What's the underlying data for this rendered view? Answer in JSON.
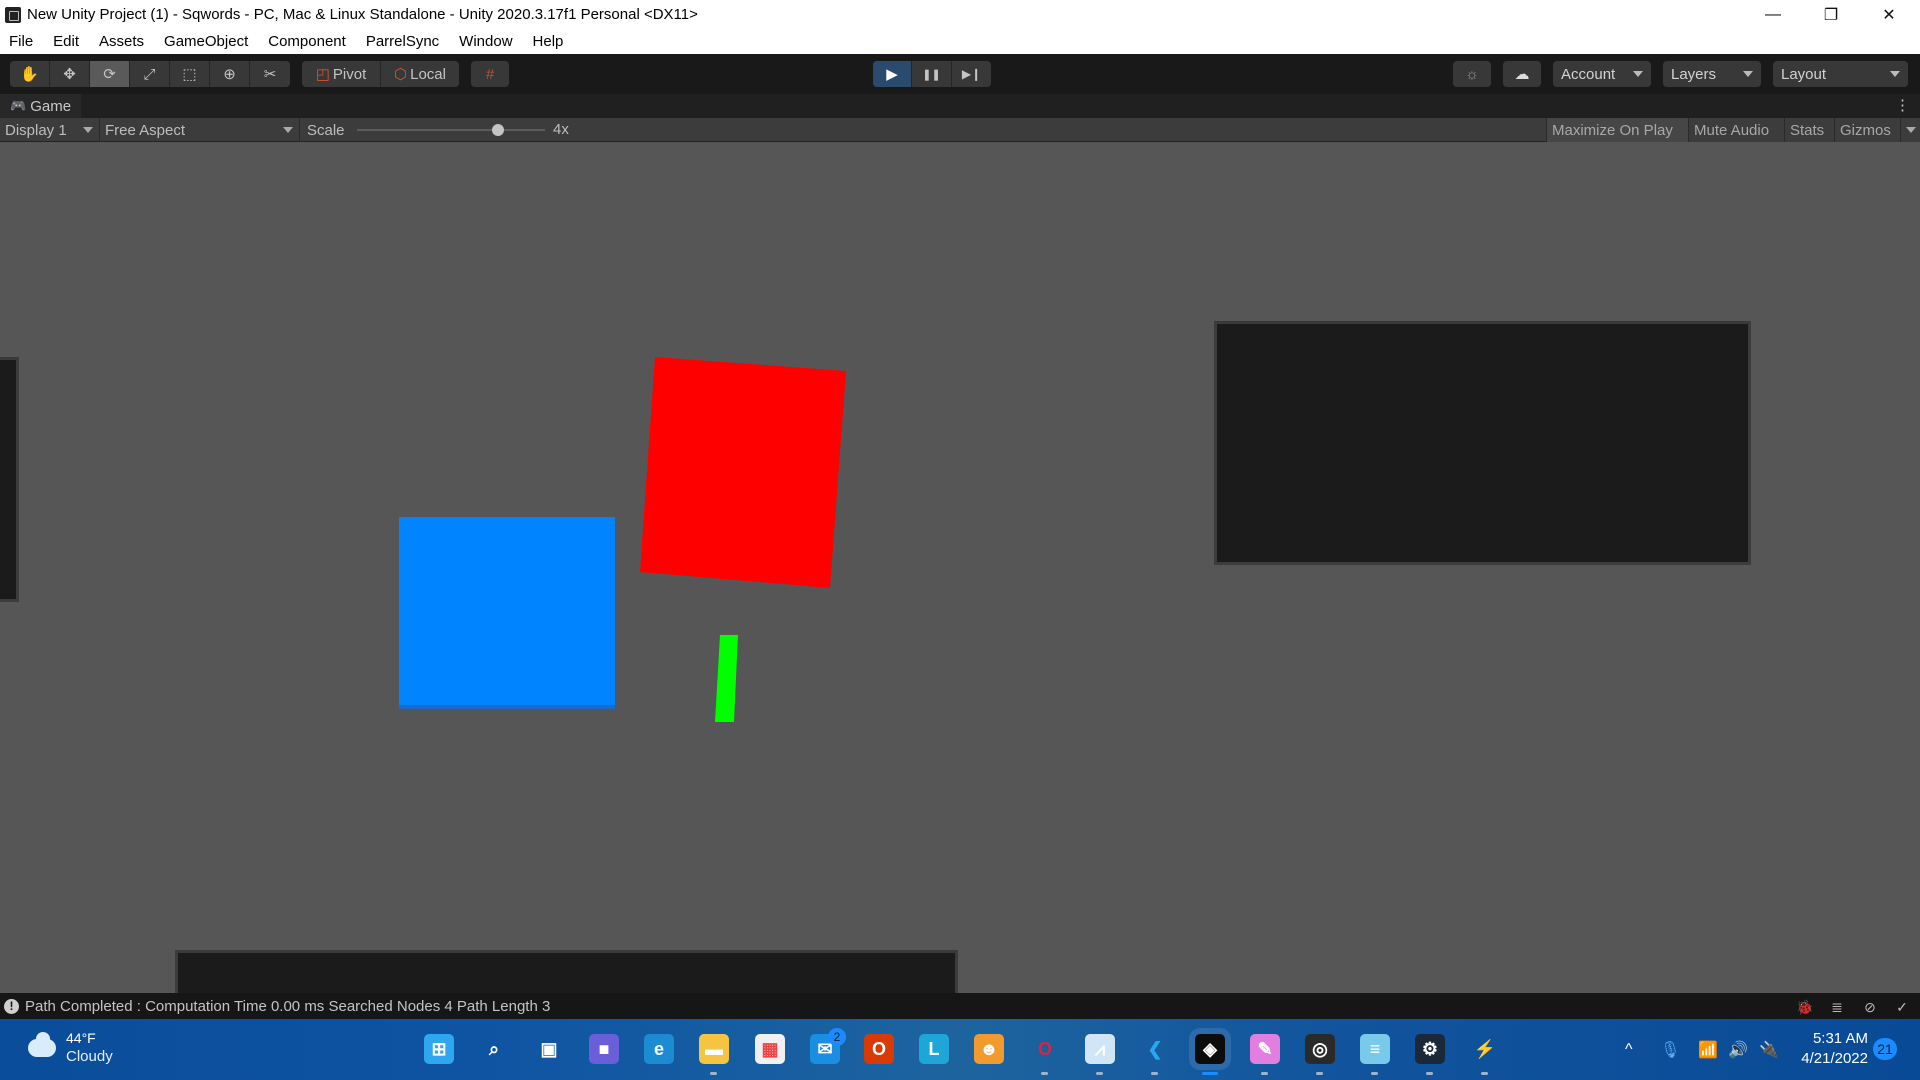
{
  "window": {
    "title": "New Unity Project (1) - Sqwords - PC, Mac & Linux Standalone - Unity 2020.3.17f1 Personal <DX11>",
    "controls": {
      "minimize": "—",
      "restore": "❐",
      "close": "✕"
    }
  },
  "menu": [
    "File",
    "Edit",
    "Assets",
    "GameObject",
    "Component",
    "ParrelSync",
    "Window",
    "Help"
  ],
  "toolbar": {
    "tools": [
      {
        "name": "hand-tool",
        "glyph": "✋",
        "active": false
      },
      {
        "name": "move-tool",
        "glyph": "✥",
        "active": false
      },
      {
        "name": "rotate-tool",
        "glyph": "⟳",
        "active": true
      },
      {
        "name": "scale-tool",
        "glyph": "⤢",
        "active": false
      },
      {
        "name": "rect-tool",
        "glyph": "⬚",
        "active": false
      },
      {
        "name": "transform-tool",
        "glyph": "⊕",
        "active": false
      },
      {
        "name": "custom-tool",
        "glyph": "✂",
        "active": false
      }
    ],
    "pivot_label": "Pivot",
    "local_label": "Local",
    "snap_glyph": "#",
    "play": {
      "play": "▶",
      "pause": "❚❚",
      "step": "▶❙"
    },
    "play_active_color": "#2a4a6e",
    "account_label": "Account",
    "layers_label": "Layers",
    "layout_label": "Layout"
  },
  "game_tab": {
    "label": "Game",
    "display": "Display 1",
    "aspect": "Free Aspect",
    "scale_label": "Scale",
    "scale_value": "4x",
    "scale_fraction": 0.75,
    "right_buttons": [
      "Maximize On Play",
      "Mute Audio",
      "Stats",
      "Gizmos"
    ]
  },
  "scene": {
    "background": "#565656",
    "objects": [
      {
        "name": "blue-square",
        "color": "#0084ff"
      },
      {
        "name": "red-square",
        "color": "#ff0000"
      },
      {
        "name": "green-bar",
        "color": "#00ff00"
      }
    ],
    "panel_color": "#1b1b1b"
  },
  "status": {
    "message": "Path Completed : Computation Time 0.00 ms Searched Nodes 4 Path Length 3"
  },
  "taskbar": {
    "weather_temp": "44°F",
    "weather_desc": "Cloudy",
    "apps": [
      {
        "name": "start",
        "glyph": "⊞",
        "bg": "#2ea6f0"
      },
      {
        "name": "search",
        "glyph": "⌕",
        "bg": "transparent"
      },
      {
        "name": "task-view",
        "glyph": "▣",
        "bg": "transparent"
      },
      {
        "name": "teams-chat",
        "glyph": "■",
        "bg": "#6a5fd8"
      },
      {
        "name": "edge",
        "glyph": "e",
        "bg": "#1c8bd1"
      },
      {
        "name": "file-explorer",
        "glyph": "▬",
        "bg": "#f5c542"
      },
      {
        "name": "microsoft-store",
        "glyph": "▦",
        "bg": "#f0f0f0"
      },
      {
        "name": "mail",
        "glyph": "✉",
        "bg": "#1a8ee0",
        "badge": "2"
      },
      {
        "name": "office",
        "glyph": "O",
        "bg": "#d83b01"
      },
      {
        "name": "l-app",
        "glyph": "L",
        "bg": "#1fa6d8"
      },
      {
        "name": "orange-app",
        "glyph": "☻",
        "bg": "#f29a2e"
      },
      {
        "name": "opera",
        "glyph": "O",
        "bg": "transparent"
      },
      {
        "name": "resource-monitor",
        "glyph": "⩘",
        "bg": "#d0e6f7"
      },
      {
        "name": "vscode",
        "glyph": "❮",
        "bg": "transparent"
      },
      {
        "name": "unity",
        "glyph": "◈",
        "bg": "#0c0c0c"
      },
      {
        "name": "krita",
        "glyph": "✎",
        "bg": "#e27ee0"
      },
      {
        "name": "obs",
        "glyph": "◎",
        "bg": "#2a2a2a"
      },
      {
        "name": "notepad",
        "glyph": "≡",
        "bg": "#79c9e8"
      },
      {
        "name": "steam",
        "glyph": "⚙",
        "bg": "#1b2838"
      },
      {
        "name": "power-app",
        "glyph": "⚡",
        "bg": "transparent"
      }
    ],
    "tray": {
      "chevron": "^",
      "mic": "🎙",
      "wifi": "◠",
      "volume": "🔊",
      "battery": "▭"
    },
    "time": "5:31 AM",
    "date": "4/21/2022",
    "notifications": "21"
  }
}
